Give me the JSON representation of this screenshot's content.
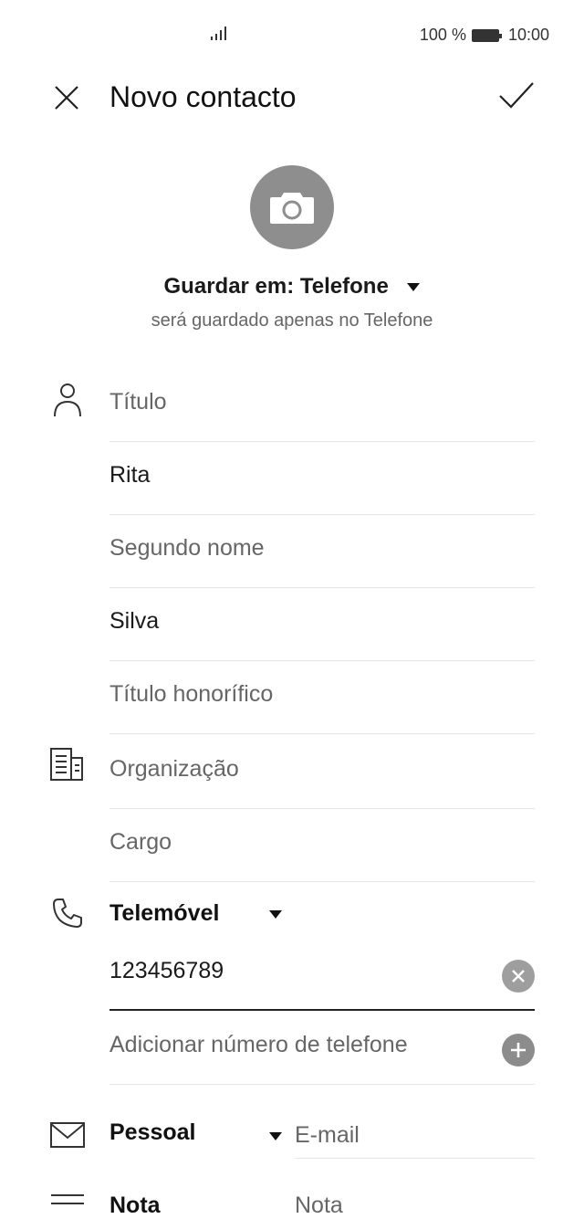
{
  "status_bar": {
    "battery_percent": "100 %",
    "time": "10:00"
  },
  "header": {
    "title": "Novo contacto"
  },
  "account": {
    "save_in": "Guardar em: Telefone",
    "note": "será guardado apenas no Telefone"
  },
  "name_fields": {
    "title_placeholder": "Título",
    "first_name": "Rita",
    "middle_placeholder": "Segundo nome",
    "last_name": "Silva",
    "suffix_placeholder": "Título honorífico"
  },
  "org_fields": {
    "org_placeholder": "Organização",
    "job_placeholder": "Cargo"
  },
  "phone": {
    "type_label": "Telemóvel",
    "number": "123456789",
    "add_placeholder": "Adicionar número de telefone"
  },
  "email": {
    "type_label": "Pessoal",
    "placeholder": "E-mail"
  },
  "note": {
    "type_label": "Nota",
    "placeholder": "Nota"
  },
  "icons": [
    "signal-icon",
    "battery-icon",
    "close-icon",
    "check-icon",
    "camera-icon",
    "person-icon",
    "organization-icon",
    "phone-icon",
    "mail-icon",
    "note-icon",
    "clear-icon",
    "add-icon",
    "dropdown-triangle-icon"
  ]
}
